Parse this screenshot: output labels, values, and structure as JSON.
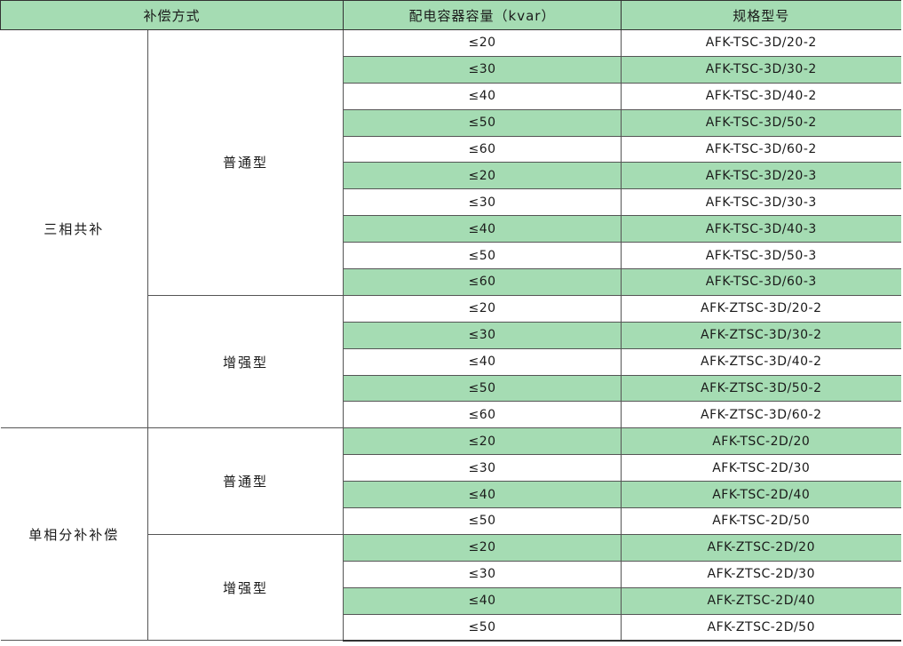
{
  "colors": {
    "stripe": "#a5dcb3",
    "border": "#333333",
    "text": "#1a1a1a"
  },
  "header": {
    "mode": "补偿方式",
    "capacity": "配电容器容量（kvar）",
    "model": "规格型号"
  },
  "groups": [
    {
      "name": "三相共补",
      "subgroups": [
        {
          "name": "普通型",
          "rows": [
            {
              "capacity": "≤20",
              "model": "AFK-TSC-3D/20-2"
            },
            {
              "capacity": "≤30",
              "model": "AFK-TSC-3D/30-2"
            },
            {
              "capacity": "≤40",
              "model": "AFK-TSC-3D/40-2"
            },
            {
              "capacity": "≤50",
              "model": "AFK-TSC-3D/50-2"
            },
            {
              "capacity": "≤60",
              "model": "AFK-TSC-3D/60-2"
            },
            {
              "capacity": "≤20",
              "model": "AFK-TSC-3D/20-3"
            },
            {
              "capacity": "≤30",
              "model": "AFK-TSC-3D/30-3"
            },
            {
              "capacity": "≤40",
              "model": "AFK-TSC-3D/40-3"
            },
            {
              "capacity": "≤50",
              "model": "AFK-TSC-3D/50-3"
            },
            {
              "capacity": "≤60",
              "model": "AFK-TSC-3D/60-3"
            }
          ]
        },
        {
          "name": "增强型",
          "rows": [
            {
              "capacity": "≤20",
              "model": "AFK-ZTSC-3D/20-2"
            },
            {
              "capacity": "≤30",
              "model": "AFK-ZTSC-3D/30-2"
            },
            {
              "capacity": "≤40",
              "model": "AFK-ZTSC-3D/40-2"
            },
            {
              "capacity": "≤50",
              "model": "AFK-ZTSC-3D/50-2"
            },
            {
              "capacity": "≤60",
              "model": "AFK-ZTSC-3D/60-2"
            }
          ]
        }
      ]
    },
    {
      "name": "单相分补补偿",
      "subgroups": [
        {
          "name": "普通型",
          "rows": [
            {
              "capacity": "≤20",
              "model": "AFK-TSC-2D/20"
            },
            {
              "capacity": "≤30",
              "model": "AFK-TSC-2D/30"
            },
            {
              "capacity": "≤40",
              "model": "AFK-TSC-2D/40"
            },
            {
              "capacity": "≤50",
              "model": "AFK-TSC-2D/50"
            }
          ]
        },
        {
          "name": "增强型",
          "rows": [
            {
              "capacity": "≤20",
              "model": "AFK-ZTSC-2D/20"
            },
            {
              "capacity": "≤30",
              "model": "AFK-ZTSC-2D/30"
            },
            {
              "capacity": "≤40",
              "model": "AFK-ZTSC-2D/40"
            },
            {
              "capacity": "≤50",
              "model": "AFK-ZTSC-2D/50"
            }
          ]
        }
      ]
    }
  ]
}
